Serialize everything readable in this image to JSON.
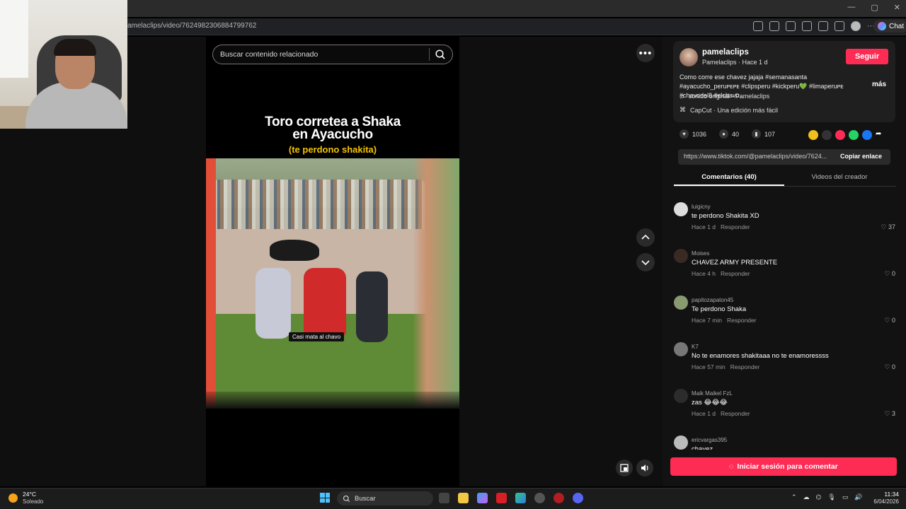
{
  "browser": {
    "url": "amelaclips/video/7624982306884799762",
    "chat_label": "Chat"
  },
  "player": {
    "search_placeholder": "Buscar contenido relacionado",
    "title_line1": "Toro corretea a Shaka",
    "title_line2": "en Ayacucho",
    "subtitle": "(te perdono shakita)",
    "caption": "Casi mata al chavo",
    "more_label": "•••"
  },
  "post": {
    "username": "pamelaclips",
    "display": "Pamelaclips · Hace 1 d",
    "follow_label": "Seguir",
    "description": "Como corre ese chavez jajaja #semanasanta #ayacucho_peruᴘᴇᴘᴇ #clipsperu #kickperu💚 #limaperuᴘᴇ #chavodel8 #elchavo...",
    "more_label": "más",
    "sound": "sonido original - Pamelaclips",
    "capcut": "CapCut · Una edición más fácil",
    "likes": "1036",
    "comments": "40",
    "saves": "107",
    "link": "https://www.tiktok.com/@pamelaclips/video/7624...",
    "copy_label": "Copiar enlace",
    "tab_comments": "Comentarios (40)",
    "tab_creator": "Videos del creador",
    "login_label": "Iniciar sesión para comentar"
  },
  "comments": [
    {
      "user": "luigicny",
      "text": "te perdono Shakita XD",
      "time": "Hace 1 d",
      "reply": "Responder",
      "likes": "37"
    },
    {
      "user": "Moises",
      "text": "CHAVEZ ARMY PRESENTE",
      "time": "Hace 4 h",
      "reply": "Responder",
      "likes": "0"
    },
    {
      "user": "papitozapaton45",
      "text": "Te perdono Shaka",
      "time": "Hace 7 min",
      "reply": "Responder",
      "likes": "0"
    },
    {
      "user": "K7",
      "text": "No te enamores shakitaaa no te enamoressss",
      "time": "Hace 57 min",
      "reply": "Responder",
      "likes": "0"
    },
    {
      "user": "Maik Maikel FzL",
      "text": "zas 😂😂😂",
      "time": "Hace 1 d",
      "reply": "Responder",
      "likes": "3"
    },
    {
      "user": "ericvargas395",
      "text": "chavez",
      "time": "",
      "reply": "",
      "likes": ""
    }
  ],
  "taskbar": {
    "temp": "24°C",
    "weather": "Soleado",
    "search_label": "Buscar",
    "time": "11:34",
    "date": "6/04/2026"
  }
}
